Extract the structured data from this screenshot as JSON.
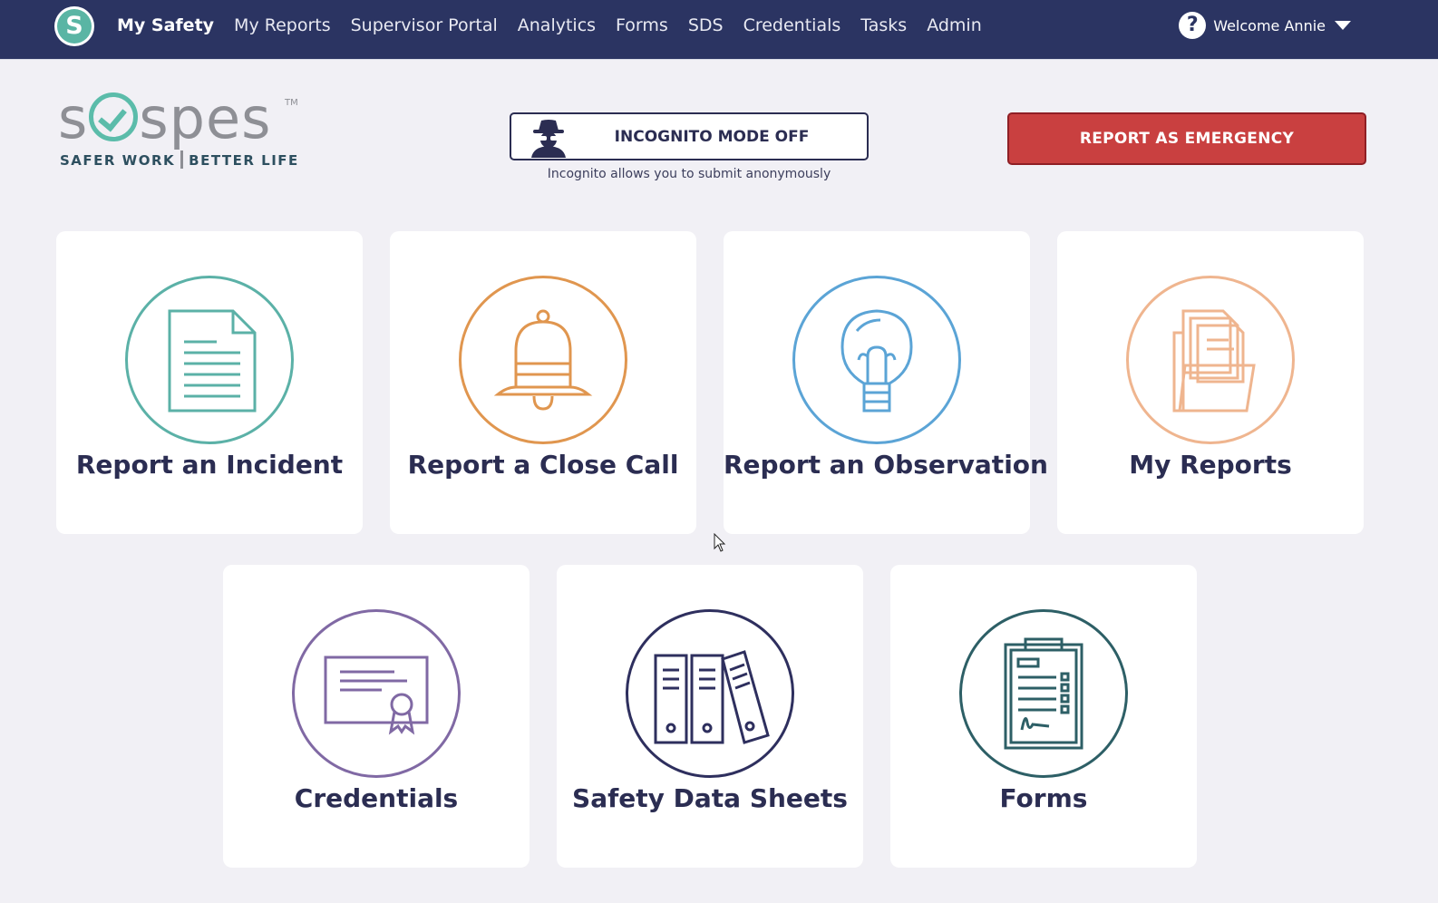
{
  "nav": {
    "logo_letter": "S",
    "items": [
      {
        "label": "My Safety",
        "active": true
      },
      {
        "label": "My Reports"
      },
      {
        "label": "Supervisor Portal"
      },
      {
        "label": "Analytics"
      },
      {
        "label": "Forms"
      },
      {
        "label": "SDS"
      },
      {
        "label": "Credentials"
      },
      {
        "label": "Tasks"
      },
      {
        "label": "Admin"
      }
    ],
    "help_glyph": "?",
    "welcome": "Welcome Annie"
  },
  "brand": {
    "word_start": "s",
    "word_end": "spes",
    "tm": "TM",
    "tag_left": "SAFER WORK",
    "tag_right": "BETTER LIFE"
  },
  "incognito": {
    "button_label": "INCOGNITO MODE OFF",
    "hint": "Incognito allows you to submit anonymously",
    "icon": "spy-icon"
  },
  "emergency": {
    "label": "REPORT AS EMERGENCY",
    "color": "#c94040"
  },
  "cards": [
    {
      "label": "Report an Incident",
      "icon": "document-icon",
      "color": "#5bb1a7"
    },
    {
      "label": "Report a Close Call",
      "icon": "bell-icon",
      "color": "#e0964f"
    },
    {
      "label": "Report an Observation",
      "icon": "lightbulb-icon",
      "color": "#5ba4d6"
    },
    {
      "label": "My Reports",
      "icon": "folder-icon",
      "color": "#efb58f"
    },
    {
      "label": "Credentials",
      "icon": "certificate-icon",
      "color": "#8069a4"
    },
    {
      "label": "Safety Data Sheets",
      "icon": "binders-icon",
      "color": "#2e2f5e"
    },
    {
      "label": "Forms",
      "icon": "clipboard-icon",
      "color": "#2d5f66"
    }
  ]
}
